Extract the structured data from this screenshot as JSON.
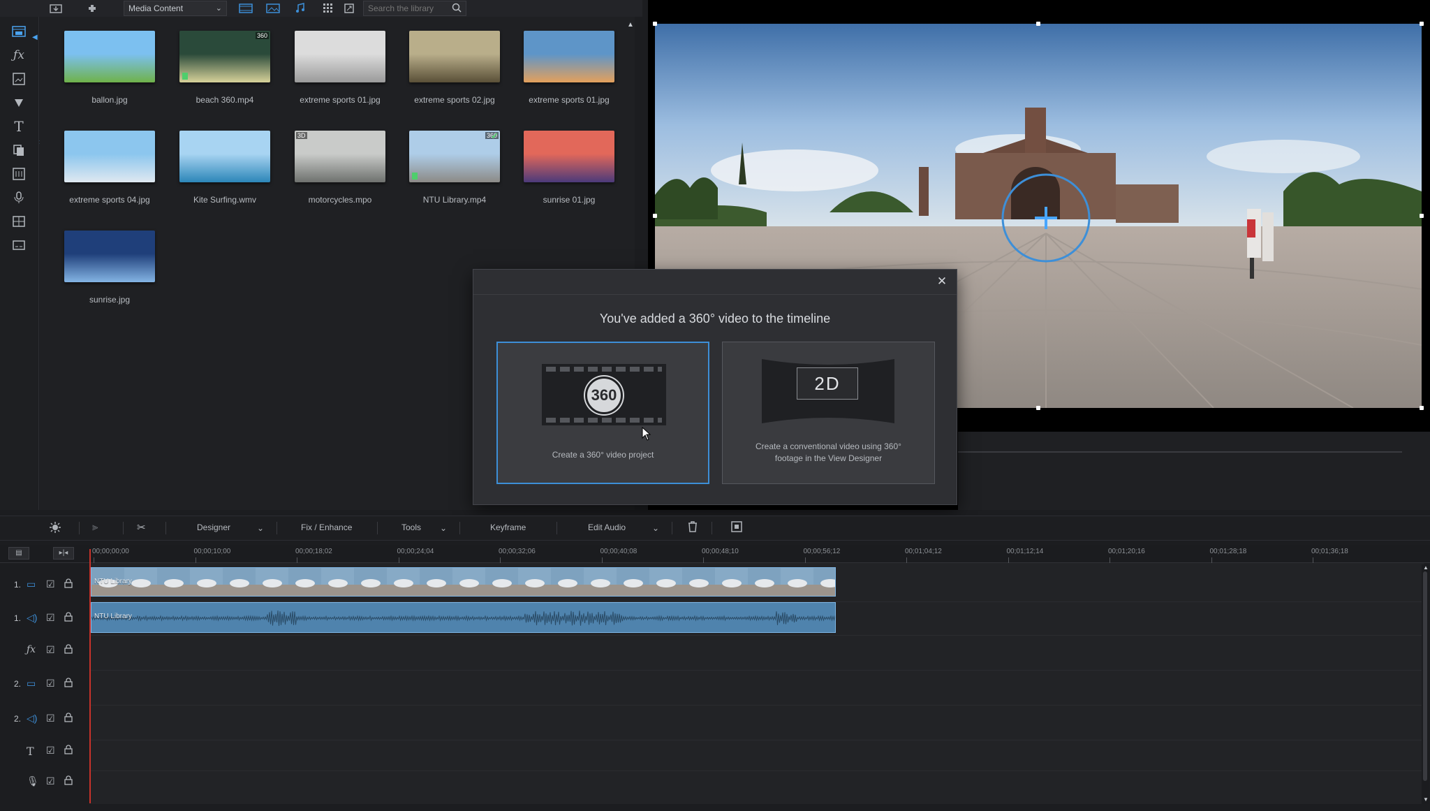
{
  "library": {
    "toolbar": {
      "import_icon": "import-media-icon",
      "plugins_icon": "plugin-icon",
      "content_dropdown": "Media Content",
      "view_icons": [
        "video-filter-icon",
        "image-filter-icon",
        "audio-filter-icon",
        "grid-view-icon",
        "expand-icon"
      ],
      "search_placeholder": "Search the library"
    },
    "rail": [
      "media-room-icon",
      "fx-room-icon",
      "pip-room-icon",
      "particle-room-icon",
      "title-room-icon",
      "transition-room-icon",
      "audio-mixing-room-icon",
      "voice-over-icon",
      "chapter-room-icon",
      "subtitle-room-icon"
    ],
    "items": [
      {
        "name": "ballon.jpg",
        "badge": "",
        "colors": [
          "#7cc0f0",
          "#6fb24a"
        ]
      },
      {
        "name": "beach 360.mp4",
        "badge": "360",
        "colors": [
          "#2a4a3a",
          "#d7d29a"
        ]
      },
      {
        "name": "extreme sports 01.jpg",
        "badge": "",
        "colors": [
          "#dcdcdc",
          "#9a9a9a"
        ]
      },
      {
        "name": "extreme sports 02.jpg",
        "badge": "",
        "colors": [
          "#b9ae8a",
          "#5a5038"
        ]
      },
      {
        "name": "extreme sports 01.jpg",
        "badge": "",
        "colors": [
          "#5e95c8",
          "#e4a05c"
        ]
      },
      {
        "name": "extreme sports 04.jpg",
        "badge": "",
        "colors": [
          "#8cc6ee",
          "#dfe8f0"
        ]
      },
      {
        "name": "Kite Surfing.wmv",
        "badge": "",
        "colors": [
          "#a8d4f2",
          "#2c86b8"
        ]
      },
      {
        "name": "motorcycles.mpo",
        "badge": "3D",
        "colors": [
          "#c9cbc9",
          "#6e716e"
        ]
      },
      {
        "name": "NTU Library.mp4",
        "badge": "360",
        "colors": [
          "#aecde8",
          "#8c8a86"
        ]
      },
      {
        "name": "sunrise 01.jpg",
        "badge": "",
        "colors": [
          "#e2685a",
          "#4b3a7a"
        ]
      },
      {
        "name": "sunrise.jpg",
        "badge": "",
        "colors": [
          "#1f3f7a",
          "#84b4e4"
        ]
      }
    ]
  },
  "dialog": {
    "title": "You've added a 360° video to the timeline",
    "option_360_badge": "360",
    "option_360_caption": "Create a 360° video project",
    "option_2d_badge": "2D",
    "option_2d_caption_line1": "Create a conventional video using 360°",
    "option_2d_caption_line2": "footage in the View Designer"
  },
  "edit_toolbar": {
    "designer": "Designer",
    "fix_enhance": "Fix / Enhance",
    "tools": "Tools",
    "keyframe": "Keyframe",
    "edit_audio": "Edit Audio"
  },
  "timeline": {
    "ruler": [
      "00;00;00;00",
      "00;00;10;00",
      "00;00;18;02",
      "00;00;24;04",
      "00;00;32;06",
      "00;00;40;08",
      "00;00;48;10",
      "00;00;56;12",
      "00;01;04;12",
      "00;01;12;14",
      "00;01;20;16",
      "00;01;28;18",
      "00;01;36;18"
    ],
    "tracks": [
      {
        "num": "1.",
        "type": "video-track-icon"
      },
      {
        "num": "1.",
        "type": "audio-track-icon"
      },
      {
        "num": "",
        "type": "fx-track-icon"
      },
      {
        "num": "2.",
        "type": "video-track-icon"
      },
      {
        "num": "2.",
        "type": "audio-track-icon"
      },
      {
        "num": "",
        "type": "title-track-icon"
      },
      {
        "num": "",
        "type": "voice-track-icon"
      }
    ],
    "video_clip_name": "NTU Library",
    "audio_clip_name": "NTU Library"
  },
  "colors": {
    "accent": "#3d8fd8",
    "playhead": "#c8322a",
    "clip_border": "#7fb7e6"
  }
}
